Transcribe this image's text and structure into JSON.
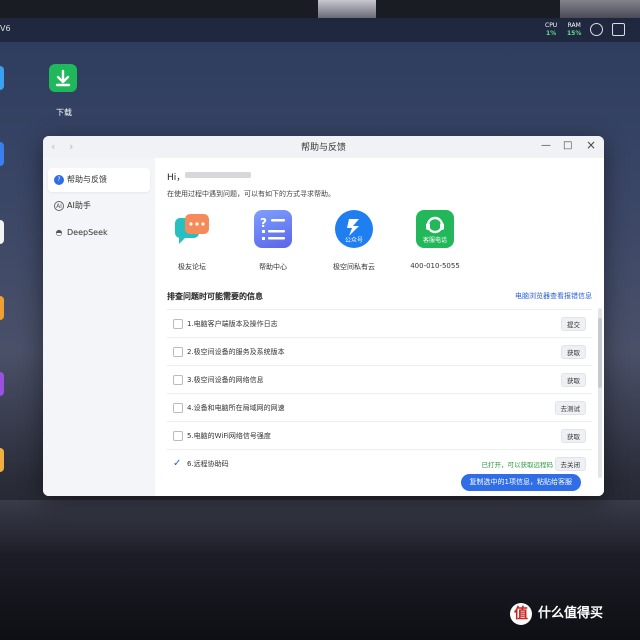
{
  "desktop": {
    "corner_label": "V6",
    "stats": [
      {
        "label": "CPU",
        "value": "1%"
      },
      {
        "label": "RAM",
        "value": "15%"
      }
    ],
    "icons": [
      {
        "label": "下载",
        "icon": "download-icon",
        "color": "#1fb85b"
      }
    ],
    "watermark": "值 什么值得买"
  },
  "window": {
    "title": "帮助与反馈",
    "nav_back": "‹",
    "nav_forward": "›",
    "controls": {
      "close": "×",
      "maximize": "□",
      "minimize": "—"
    }
  },
  "sidebar": {
    "items": [
      {
        "label": "帮助与反馈",
        "icon": "question-icon",
        "active": true
      },
      {
        "label": "AI助手",
        "icon": "ai-icon",
        "active": false
      },
      {
        "label": "DeepSeek",
        "icon": "deepseek-icon",
        "active": false
      }
    ]
  },
  "main": {
    "greeting": "Hi，",
    "intro": "在使用过程中遇到问题，可以有如下的方式寻求帮助。",
    "cards": [
      {
        "label": "极友论坛",
        "icon": "forum-chat-icon"
      },
      {
        "label": "帮助中心",
        "icon": "help-center-icon"
      },
      {
        "label": "极空间私有云",
        "icon": "official-account-icon",
        "badge": "公众号"
      },
      {
        "label": "400-010-5055",
        "icon": "customer-service-icon",
        "badge": "客服电话"
      }
    ],
    "section_title": "排查问题时可能需要的信息",
    "section_link": "电脑浏览器查看报错信息",
    "rows": [
      {
        "text": "1.电脑客户端版本及操作日志",
        "button": "提交",
        "checked": false,
        "status": ""
      },
      {
        "text": "2.极空间设备的服务及系统版本",
        "button": "获取",
        "checked": false,
        "status": ""
      },
      {
        "text": "3.极空间设备的网络信息",
        "button": "获取",
        "checked": false,
        "status": ""
      },
      {
        "text": "4.设备和电脑所在局域网的网速",
        "button": "去测试",
        "checked": false,
        "status": ""
      },
      {
        "text": "5.电脑的WiFi网络信号强度",
        "button": "获取",
        "checked": false,
        "status": ""
      },
      {
        "text": "6.远程协助码",
        "button": "去关闭",
        "checked": true,
        "status": "已打开，可以获取远程码"
      }
    ],
    "primary_button": "复制选中的1项信息，粘贴给客服"
  }
}
